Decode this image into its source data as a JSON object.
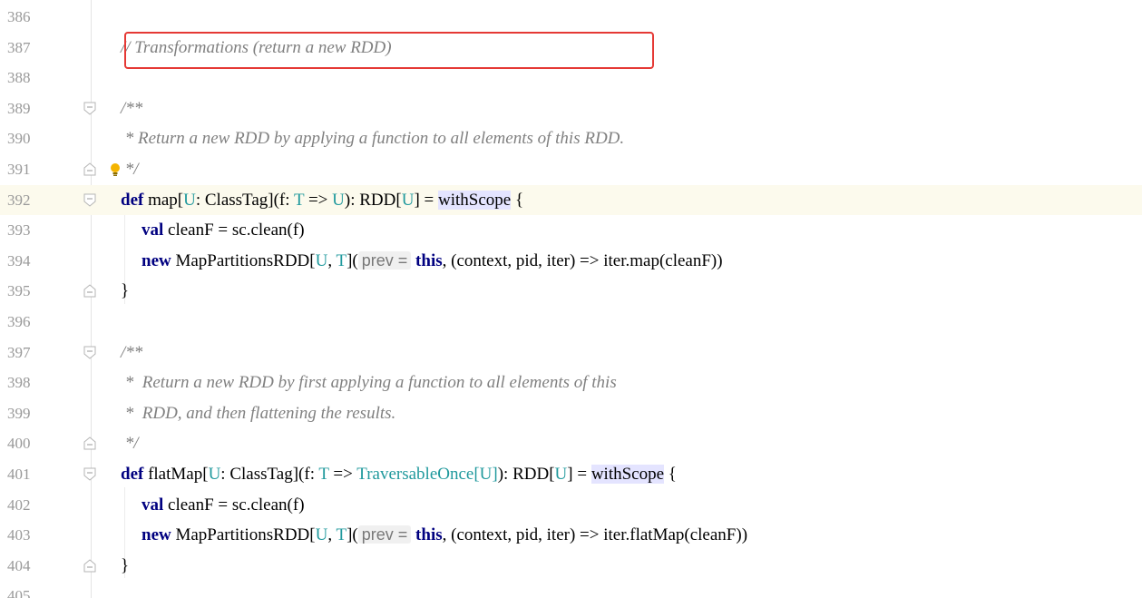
{
  "editor": {
    "lines": [
      {
        "num": "386",
        "text": ""
      },
      {
        "num": "387",
        "text": "// Transformations (return a new RDD)"
      },
      {
        "num": "388",
        "text": ""
      },
      {
        "num": "389",
        "text": "/**"
      },
      {
        "num": "390",
        "text": " * Return a new RDD by applying a function to all elements of this RDD."
      },
      {
        "num": "391",
        "text": " */"
      },
      {
        "num": "392",
        "text": ""
      },
      {
        "num": "393",
        "text": ""
      },
      {
        "num": "394",
        "text": ""
      },
      {
        "num": "395",
        "text": "}"
      },
      {
        "num": "396",
        "text": ""
      },
      {
        "num": "397",
        "text": "/**"
      },
      {
        "num": "398",
        "text": " *  Return a new RDD by first applying a function to all elements of this"
      },
      {
        "num": "399",
        "text": " *  RDD, and then flattening the results."
      },
      {
        "num": "400",
        "text": " */"
      },
      {
        "num": "401",
        "text": ""
      },
      {
        "num": "402",
        "text": ""
      },
      {
        "num": "403",
        "text": ""
      },
      {
        "num": "404",
        "text": "}"
      },
      {
        "num": "405",
        "text": ""
      }
    ],
    "tokens": {
      "def": "def",
      "val": "val",
      "new": "new",
      "this": "this",
      "map_name": " map[",
      "flatmap_name": " flatMap[",
      "U": "U",
      "T": "T",
      "classtag": ": ClassTag](f: ",
      "arrow": " => ",
      "rpar_rdd": "): RDD[",
      "rdd_end": "] = ",
      "withscope": "withScope",
      "brace_open": " {",
      "cleanf_decl": " cleanF = sc.clean(f)",
      "mpr_open": " MapPartitionsRDD[",
      "comma_sp": ", ",
      "mpr_close": "](",
      "prev_hint": "prev =",
      "sp": " ",
      "ctx": ", (context, pid, iter) => iter.map(cleanF))",
      "ctx_flat": ", (context, pid, iter) => iter.flatMap(cleanF))",
      "traversable": "TraversableOnce[",
      "close_br": "]",
      "rpar_rdd2": "): RDD["
    },
    "current_line": "392"
  },
  "colors": {
    "comment": "#808080",
    "keyword": "#000080",
    "type_param": "#20999d",
    "highlight": "#e4e4ff",
    "current_line_bg": "#fcfaed",
    "annotation_box": "#e53935"
  },
  "icons": {
    "fold_open": "fold-open-icon",
    "fold_close": "fold-close-icon",
    "intention": "lightbulb-icon"
  }
}
